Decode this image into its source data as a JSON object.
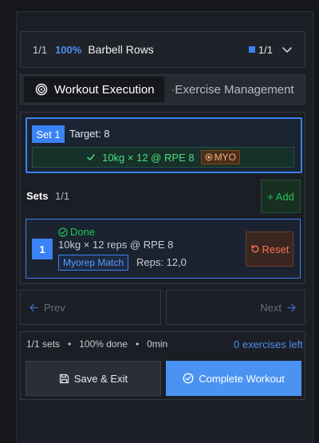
{
  "header": {
    "count": "1/1",
    "percent": "100%",
    "exercise_name": "Barbell Rows",
    "progress": "1/1"
  },
  "tabs": [
    {
      "label": "Workout Execution"
    },
    {
      "label": "Exercise Management"
    }
  ],
  "current_set": {
    "badge": "Set 1",
    "target": "Target: 8",
    "logged": "10kg × 12 @ RPE 8",
    "tag": "MYO"
  },
  "sets": {
    "label": "Sets",
    "count": "1/1",
    "add_label": "+ Add",
    "items": [
      {
        "number": "1",
        "status": "Done",
        "detail": "10kg × 12 reps @ RPE 8",
        "type_badge": "Myorep Match",
        "reps": "Reps: 12,0",
        "reset_label": "Reset"
      }
    ]
  },
  "nav": {
    "prev_label": "Prev",
    "next_label": "Next"
  },
  "footer": {
    "sets_done": "1/1 sets",
    "percent_done": "100% done",
    "duration": "0min",
    "exercises_left": "0 exercises left",
    "save_label": "Save & Exit",
    "complete_label": "Complete Workout"
  },
  "colors": {
    "accent": "#3b82f6",
    "success": "#22c55e",
    "warning": "#f97356",
    "background": "#15171c"
  }
}
